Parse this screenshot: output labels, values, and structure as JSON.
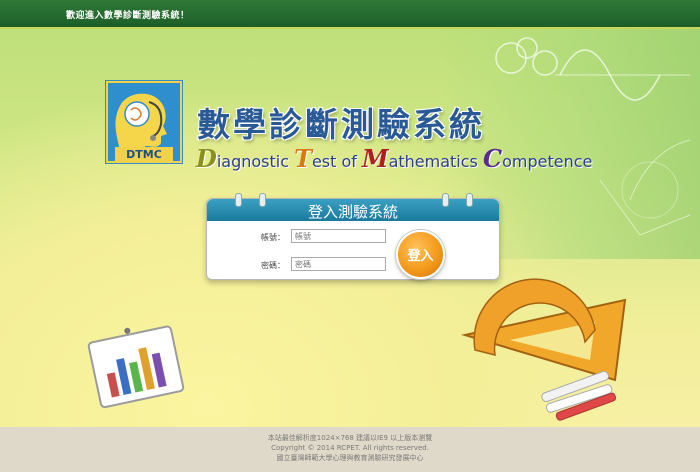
{
  "header": {
    "welcome": "歡迎進入數學診斷測驗系統！"
  },
  "brand": {
    "logo_text": "DTMC",
    "title": "數學診斷測驗系統",
    "subtitle": [
      {
        "cap": "D",
        "rest": "iagnostic "
      },
      {
        "cap": "T",
        "rest": "est of "
      },
      {
        "cap": "M",
        "rest": "athematics "
      },
      {
        "cap": "C",
        "rest": "ompetence"
      }
    ]
  },
  "login": {
    "title": "登入測驗系統",
    "account_label": "帳號：",
    "account_placeholder": "帳號",
    "password_label": "密碼：",
    "password_placeholder": "密碼",
    "submit_label": "登入"
  },
  "footer": {
    "line1": "本站最佳解析度1024×768 建議以IE9 以上版本瀏覽",
    "line2": "Copyright © 2014 RCPET. All rights reserved.",
    "line3": "國立臺灣師範大學心理與教育測驗研究發展中心"
  },
  "colors": {
    "topbar": "#2f7a37",
    "login_header": "#1a7a9e",
    "login_button": "#f39a1c",
    "title": "#2a5a96"
  }
}
